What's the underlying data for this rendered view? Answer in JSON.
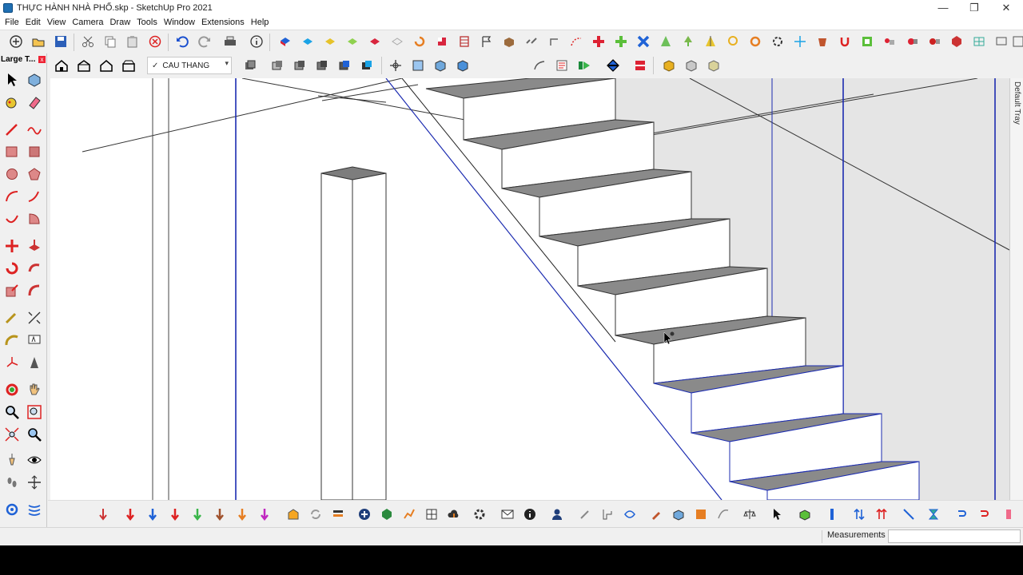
{
  "window": {
    "title": "THỰC HÀNH NHÀ PHỐ.skp - SketchUp Pro 2021",
    "minimize": "—",
    "restore": "❐",
    "close": "✕"
  },
  "menu": [
    {
      "label": "File"
    },
    {
      "label": "Edit"
    },
    {
      "label": "View"
    },
    {
      "label": "Camera"
    },
    {
      "label": "Draw"
    },
    {
      "label": "Tools"
    },
    {
      "label": "Window"
    },
    {
      "label": "Extensions"
    },
    {
      "label": "Help"
    }
  ],
  "scene_selector": {
    "check": "✓",
    "value": "CAU THANG",
    "arrow": "▾"
  },
  "left_panel": {
    "title": "Large T...",
    "close": "x"
  },
  "right_tray": {
    "label": "Default Tray"
  },
  "status": {
    "measurements_label": "Measurements",
    "measurements_value": ""
  },
  "colors": {
    "accent_blue": "#1a4fcf",
    "tread_gray": "#8a8a8a",
    "wall_gray": "#e6e6e6",
    "edge_blue": "#1b2bb0"
  }
}
